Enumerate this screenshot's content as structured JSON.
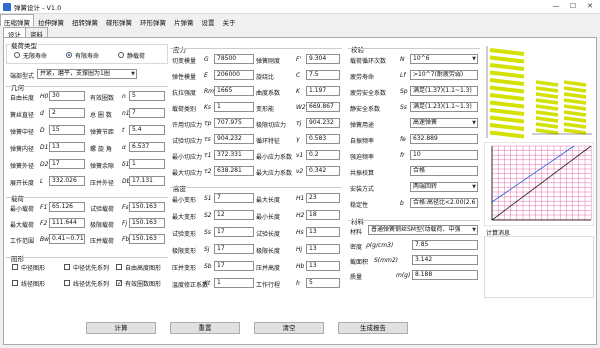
{
  "window": {
    "title": "弹簧设计 - V1.0",
    "min": "—",
    "max": "☐",
    "close": "✕"
  },
  "menu": [
    "压缩弹簧",
    "拉伸弹簧",
    "扭转弹簧",
    "碟形弹簧",
    "环形弹簧",
    "片弹簧",
    "设置",
    "关于"
  ],
  "tabs": [
    "设计",
    "资料"
  ],
  "spring_type": {
    "title": "载荷类型",
    "options": [
      "无限寿命",
      "有限寿命",
      "静载荷"
    ],
    "selected": 1
  },
  "end_type": {
    "label": "端部型式",
    "value": "并紧，磨平，支撑圈为1圈"
  },
  "geometry": {
    "title": "几何",
    "rows": [
      {
        "label": "自由长度",
        "sym": "H0",
        "value": "30",
        "label2": "有效圈数",
        "sym2": "n",
        "value2": "5"
      },
      {
        "label": "簧丝直径",
        "sym": "d",
        "value": "2",
        "label2": "总 圈 数",
        "sym2": "n1",
        "value2": "7"
      },
      {
        "label": "弹簧中径",
        "sym": "D",
        "value": "15",
        "label2": "弹簧节距",
        "sym2": "t",
        "value2": "5.4"
      },
      {
        "label": "弹簧内径",
        "sym": "D1",
        "value": "13",
        "label2": "螺 旋 角",
        "sym2": "α",
        "value2": "6.537"
      },
      {
        "label": "弹簧外径",
        "sym": "D2",
        "value": "17",
        "label2": "弹簧余隙",
        "sym2": "δ1",
        "value2": "1"
      },
      {
        "label": "展开长度",
        "sym": "L",
        "value": "332.026",
        "label2": "压并外径",
        "sym2": "Db",
        "value2": "17.131"
      }
    ]
  },
  "load": {
    "title": "载荷",
    "rows": [
      {
        "label": "最小载荷",
        "sym": "F1",
        "value": "65.126",
        "label2": "试验载荷",
        "sym2": "Fs",
        "value2": "150.163"
      },
      {
        "label": "最大载荷",
        "sym": "F2",
        "value": "111.644",
        "label2": "极限载荷",
        "sym2": "Fj",
        "value2": "150.163"
      },
      {
        "label": "工作范围",
        "sym": "Bw",
        "value": "0.41~0.71",
        "label2": "压并载荷",
        "sym2": "Fb",
        "value2": "150.163"
      }
    ]
  },
  "drawing": {
    "title": "图形",
    "options": [
      "中径图形",
      "中径优先系列",
      "自由高度图形",
      "线径图形",
      "线径优先系列",
      "有效圈数图形"
    ],
    "checked": [
      false,
      false,
      false,
      false,
      false,
      true
    ]
  },
  "stress": {
    "title": "应力",
    "rows": [
      {
        "label": "切变模量",
        "sym": "G",
        "value": "78500",
        "label2": "弹簧刚度",
        "sym2": "F'",
        "value2": "9.304"
      },
      {
        "label": "弹性模量",
        "sym": "E",
        "value": "206000",
        "label2": "旋绕比",
        "sym2": "C",
        "value2": "7.5"
      },
      {
        "label": "抗拉强度",
        "sym": "Rm",
        "value": "1665",
        "label2": "曲度系数",
        "sym2": "K",
        "value2": "1.197"
      },
      {
        "label": "载荷类别",
        "sym": "Ks",
        "value": "1",
        "label2": "变形能",
        "sym2": "W2(Nmm)",
        "value2": "669.867"
      },
      {
        "label": "许用切应力",
        "sym": "τp",
        "value": "707.975",
        "label2": "极限切应力",
        "sym2": "τj",
        "value2": "904.232"
      },
      {
        "label": "试验切应力",
        "sym": "τs",
        "value": "904.232",
        "label2": "循环特征",
        "sym2": "γ",
        "value2": "0.583"
      },
      {
        "label": "最小切应力",
        "sym": "τ1",
        "value": "372.331",
        "label2": "最小应力系数",
        "sym2": "ν1",
        "value2": "0.2"
      },
      {
        "label": "最大切应力",
        "sym": "τ2",
        "value": "638.281",
        "label2": "最大应力系数",
        "sym2": "ν2",
        "value2": "0.342"
      }
    ]
  },
  "height": {
    "title": "高度",
    "rows": [
      {
        "label": "最小变形",
        "sym": "S1",
        "value": "7",
        "label2": "最大长度",
        "sym2": "H1",
        "value2": "23"
      },
      {
        "label": "最大变形",
        "sym": "S2",
        "value": "12",
        "label2": "最小长度",
        "sym2": "H2",
        "value2": "18"
      },
      {
        "label": "试验变形",
        "sym": "Ss",
        "value": "17",
        "label2": "试验长度",
        "sym2": "Hs",
        "value2": "13"
      },
      {
        "label": "极限变形",
        "sym": "Sj",
        "value": "17",
        "label2": "极限长度",
        "sym2": "Hj",
        "value2": "13"
      },
      {
        "label": "压并变形",
        "sym": "Sb",
        "value": "17",
        "label2": "压并高度",
        "sym2": "Hb",
        "value2": "13"
      },
      {
        "label": "温度修正系数",
        "sym": "Kt",
        "value": "1",
        "label2": "工作行程",
        "sym2": "h",
        "value2": "5"
      }
    ]
  },
  "check": {
    "title": "校验",
    "rows": [
      {
        "label": "载荷循环次数",
        "sym": "N",
        "value": "10^6"
      },
      {
        "label": "疲劳寿命",
        "sym": "Lf",
        "value": ">10^7(耐疲劳弱)"
      },
      {
        "label": "疲劳安全系数",
        "sym": "Sp",
        "value": "满足(1.37)(1.1~1.3)"
      },
      {
        "label": "静安全系数",
        "sym": "Ss",
        "value": "满足(1.23)(1.1~1.3)"
      },
      {
        "label": "弹簧用途",
        "sym": "",
        "value": "高速弹簧"
      },
      {
        "label": "自振频率",
        "sym": "fe",
        "value": "632.889"
      },
      {
        "label": "强迫频率",
        "sym": "fr",
        "value": "10"
      },
      {
        "label": "共振校算",
        "sym": "",
        "value": "合格"
      },
      {
        "label": "安装方式",
        "sym": "",
        "value": "两端回转"
      },
      {
        "label": "稳定性",
        "sym": "b",
        "value": "合格:高径比<2.00(2.6"
      }
    ]
  },
  "material": {
    "title": "材料",
    "label": "材料",
    "value": "普通弹簧钢丝SM型(动载荷、中强",
    "density_label": "密度",
    "density_sym": "ρ(g/cm3)",
    "density": "7.85",
    "area_label": "截面积",
    "area_sym": "S(mm2)",
    "area": "3.142",
    "mass_label": "质量",
    "mass_sym": "m(g)",
    "mass": "8.188"
  },
  "calc_msg": "计算消息",
  "buttons": {
    "calc": "计算",
    "reset": "重置",
    "clear": "清空",
    "report": "生成报告"
  },
  "colors": {
    "accent": "#1a5fd6",
    "spring": "#d4e000",
    "grid": "#e24ba0"
  }
}
